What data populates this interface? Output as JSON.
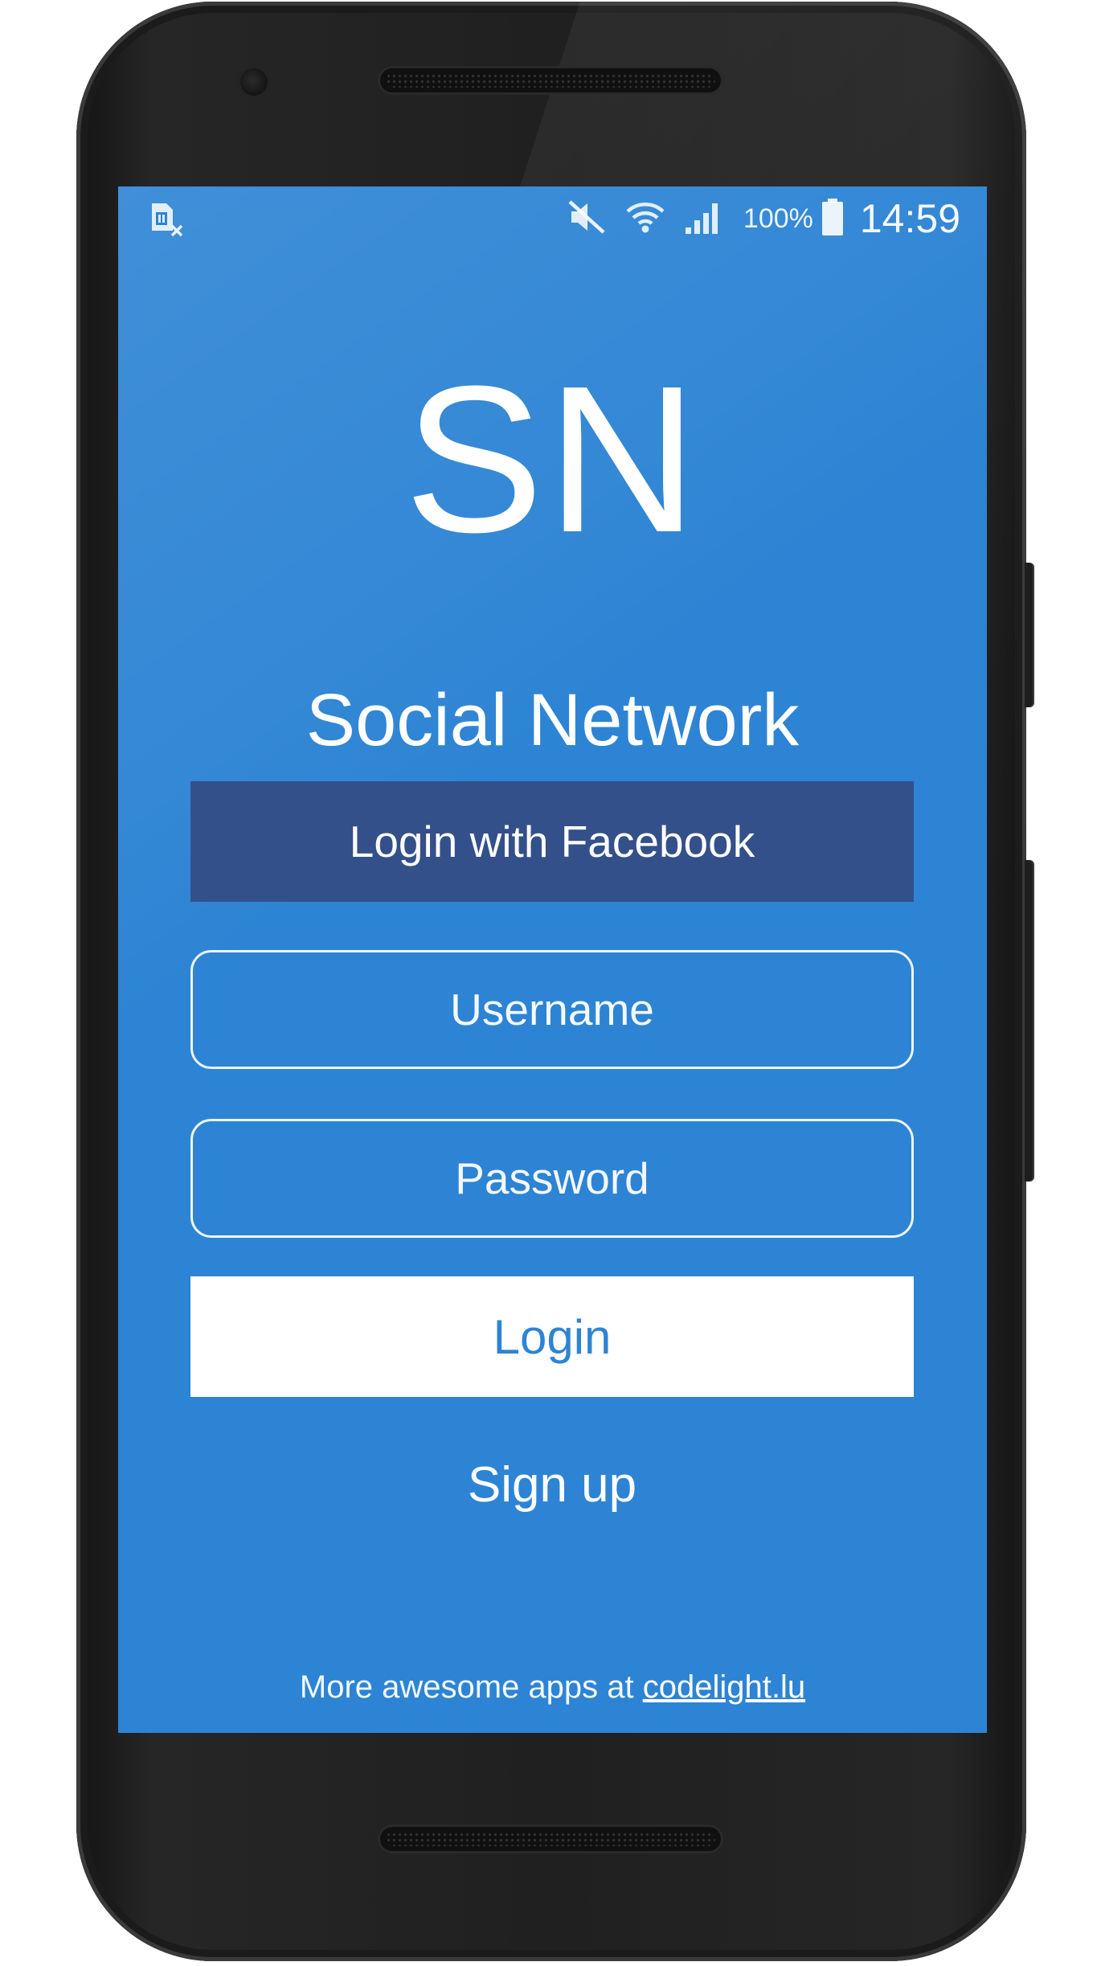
{
  "status_bar": {
    "left_icon": "sim-missing-icon",
    "icons": [
      "mute-icon",
      "wifi-icon",
      "signal-icon",
      "battery-icon"
    ],
    "battery": "100%",
    "time": "14:59"
  },
  "app": {
    "logo": "SN",
    "title": "Social Network"
  },
  "login_form": {
    "facebook_label": "Login with Facebook",
    "username_placeholder": "Username",
    "password_placeholder": "Password",
    "login_label": "Login",
    "signup_label": "Sign up"
  },
  "footer": {
    "text": "More awesome apps at ",
    "link_text": "codelight.lu"
  },
  "colors": {
    "background": "#2d84d4",
    "facebook": "#34508a",
    "login_button_bg": "#ffffff",
    "login_button_text": "#2d84d4",
    "device": "#202020"
  }
}
